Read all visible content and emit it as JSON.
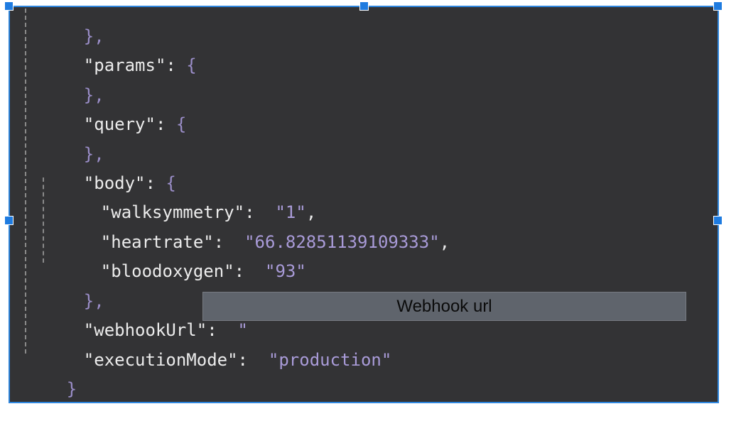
{
  "code": {
    "lines": {
      "l0": "},",
      "l1_key": "\"params\"",
      "l1_sep": ": ",
      "l1_open": "{",
      "l2": "},",
      "l3_key": "\"query\"",
      "l3_sep": ": ",
      "l3_open": "{",
      "l4": "},",
      "l5_key": "\"body\"",
      "l5_sep": ": ",
      "l5_open": "{",
      "l6_key": "\"walksymmetry\"",
      "l6_sep": ":  ",
      "l6_val": "\"1\"",
      "l6_end": ",",
      "l7_key": "\"heartrate\"",
      "l7_sep": ":  ",
      "l7_val": "\"66.82851139109333\"",
      "l7_end": ",",
      "l8_key": "\"bloodoxygen\"",
      "l8_sep": ":  ",
      "l8_val": "\"93\"",
      "l9": "},",
      "l10_key": "\"webhookUrl\"",
      "l10_sep": ":  ",
      "l10_val": "\"",
      "l11_key": "\"executionMode\"",
      "l11_sep": ":  ",
      "l11_val": "\"production\"",
      "l12": "}"
    }
  },
  "overlay": {
    "label": "Webhook url"
  },
  "colors": {
    "background": "#333335",
    "selection_border": "#2e86de",
    "string_value": "#a99bd8",
    "overlay": "#5f646c"
  }
}
